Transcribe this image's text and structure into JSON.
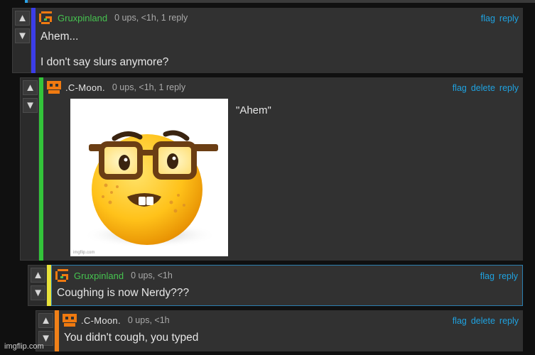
{
  "comments": [
    {
      "username": "Gruxpinland",
      "meta": "0 ups, <1h, 1 reply",
      "actions": [
        "flag",
        "reply"
      ],
      "lines": [
        "Ahem...",
        "I don't say slurs anymore?"
      ],
      "bar_color": "#3b3de8"
    },
    {
      "username": ".C-Moon.",
      "meta": "0 ups, <1h, 1 reply",
      "actions": [
        "flag",
        "delete",
        "reply"
      ],
      "caption": "\"Ahem\"",
      "image_watermark": "imgflip.com",
      "bar_color": "#33c43a"
    },
    {
      "username": "Gruxpinland",
      "meta": "0 ups, <1h",
      "actions": [
        "flag",
        "reply"
      ],
      "lines": [
        "Coughing is now Nerdy???"
      ],
      "bar_color": "#e8e23a"
    },
    {
      "username": ".C-Moon.",
      "meta": "0 ups, <1h",
      "actions": [
        "flag",
        "delete",
        "reply"
      ],
      "lines": [
        "You didn't cough, you typed"
      ],
      "bar_color": "#f08018"
    }
  ],
  "vote_icons": {
    "up": "arrow-up-icon",
    "down": "arrow-down-icon"
  },
  "avatar_icons": [
    "gruxpinland-pixel-avatar-icon",
    "cmoon-pixel-avatar-icon"
  ],
  "colors": {
    "link": "#1fa2e0",
    "username_green": "#46c450",
    "avatar_orange": "#f07a10"
  },
  "watermark": "imgflip.com"
}
